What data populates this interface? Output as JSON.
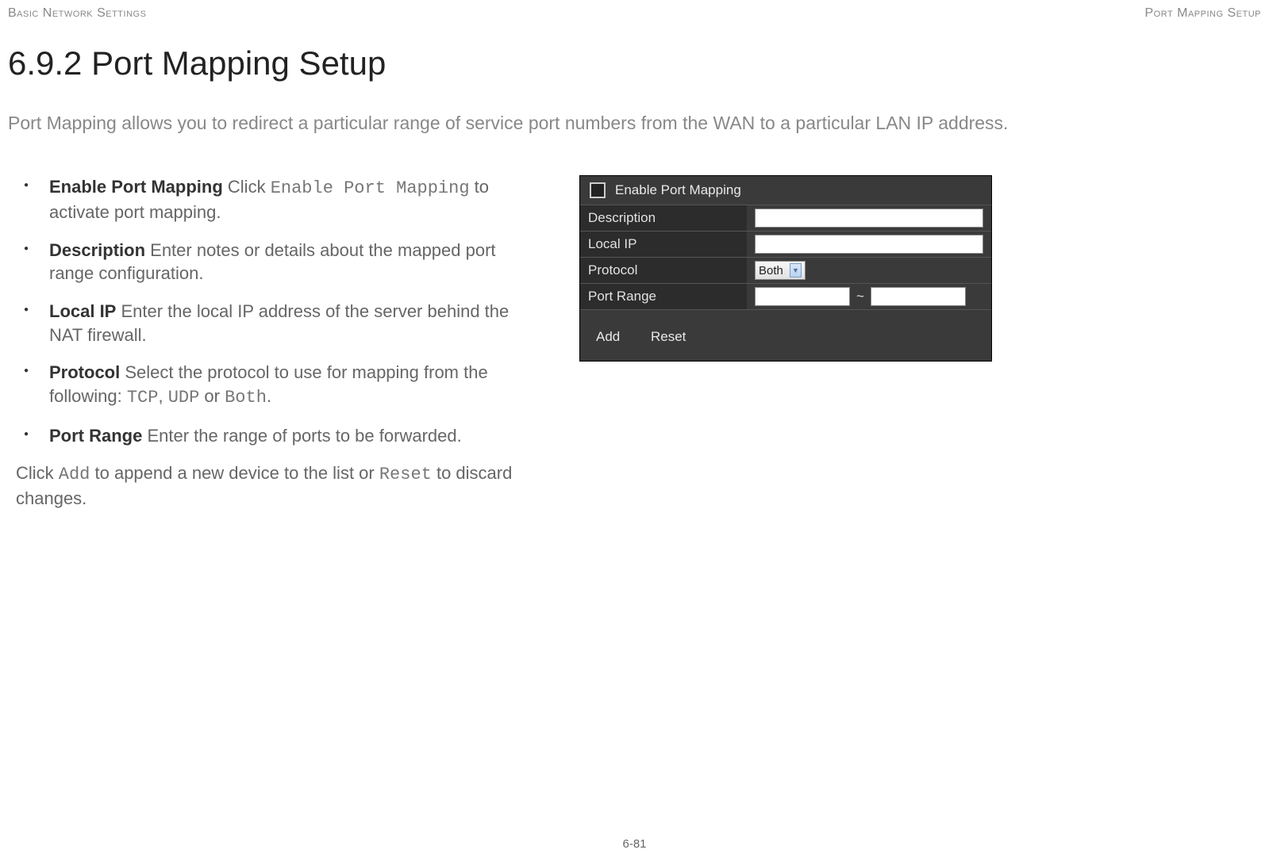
{
  "header": {
    "left": "Basic Network Settings",
    "right": "Port Mapping Setup"
  },
  "section_number_title": "6.9.2 Port Mapping Setup",
  "intro": "Port Mapping allows you to redirect a particular range of service port numbers from the WAN to a particular LAN IP address.",
  "bullets": [
    {
      "term": "Enable Port Mapping",
      "pre": "  Click ",
      "mono": "Enable Port Mapping",
      "post": " to activate port mapping."
    },
    {
      "term": "Description",
      "pre": "  Enter notes or details about the mapped port range configuration.",
      "mono": "",
      "post": ""
    },
    {
      "term": "Local IP",
      "pre": "  Enter the local IP address of the server behind the NAT firewall.",
      "mono": "",
      "post": ""
    },
    {
      "term": "Protocol",
      "pre": "  Select the protocol to use for mapping from the following: ",
      "mono": "TCP",
      "mid1": ", ",
      "mono2": "UDP",
      "mid2": " or ",
      "mono3": "Both",
      "post": "."
    },
    {
      "term": "Port Range",
      "pre": "  Enter the range of ports to be forwarded.",
      "mono": "",
      "post": ""
    }
  ],
  "click_line": {
    "pre": "Click ",
    "mono1": "Add",
    "mid": " to append a new device to the list or ",
    "mono2": "Reset",
    "post": " to discard changes."
  },
  "widget": {
    "enable_label": "Enable Port Mapping",
    "rows": {
      "description": "Description",
      "local_ip": "Local IP",
      "protocol": "Protocol",
      "protocol_value": "Both",
      "port_range": "Port Range",
      "tilde": "~"
    },
    "buttons": {
      "add": "Add",
      "reset": "Reset"
    }
  },
  "page_number": "6-81"
}
